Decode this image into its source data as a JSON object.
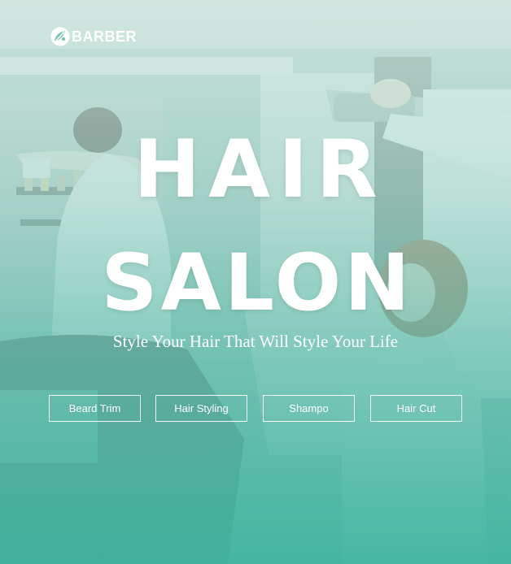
{
  "brand": {
    "name": "BARBER",
    "icon": "barber-leaf-logo"
  },
  "hero": {
    "headline_line1": "HAIR",
    "headline_line2": "SALON",
    "tagline": "Style Your Hair That Will Style Your Life",
    "overlay_color_top": "#d6ece6",
    "overlay_color_bottom": "#40b4a0"
  },
  "services": [
    {
      "label": "Beard Trim"
    },
    {
      "label": "Hair Styling"
    },
    {
      "label": "Shampo"
    },
    {
      "label": "Hair Cut"
    }
  ]
}
